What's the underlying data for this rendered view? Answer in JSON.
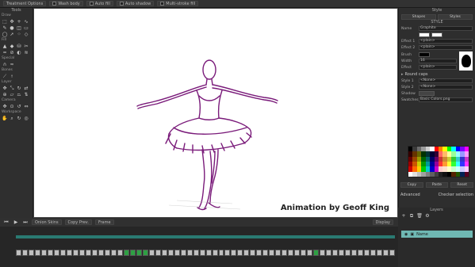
{
  "topbar": {
    "opts": [
      {
        "label": "Treatment Options"
      },
      {
        "label": "Wash body"
      },
      {
        "label": "Auto fill"
      },
      {
        "label": "Auto shadow"
      },
      {
        "label": "Multi-stroke fill"
      }
    ]
  },
  "tools": {
    "title": "Tools",
    "sections": [
      "Draw",
      "Fill",
      "Special",
      "Bones",
      "Layer",
      "Camera",
      "Workspace"
    ]
  },
  "canvas": {
    "credit": "Animation by Geoff King",
    "stroke_color": "#7a1b7a"
  },
  "right": {
    "title": "Style",
    "tabs": [
      "Shapes",
      "Styles"
    ],
    "style_header": "STYLE",
    "name_label": "Name",
    "name_value": "Graphite",
    "rows": [
      {
        "label": "Effect 1",
        "value": "<plain>"
      },
      {
        "label": "Effect 2",
        "value": "<plain>"
      },
      {
        "label": "Width",
        "value": "16"
      },
      {
        "label": "Effect",
        "value": "<plain>"
      }
    ],
    "brush_label": "Brush",
    "round_caps": "Round caps",
    "style1_label": "Style 1",
    "style1_value": "<None>",
    "style2_label": "Style 2",
    "style2_value": "<None>",
    "shadow_label": "Shadow",
    "swatches_label": "Swatches",
    "swatches_value": "Basic Colors.png",
    "copy": "Copy",
    "paste": "Paste",
    "reset": "Reset",
    "advanced": "Advanced",
    "checker": "Checker selection",
    "layers_title": "Layers",
    "layer_name": "Name"
  },
  "timeline": {
    "onion": "Onion Skins",
    "copy_prev": "Copy Prev.",
    "frame": "Frame",
    "display": "Display"
  },
  "swatch_colors": [
    "#000000",
    "#3a3a3a",
    "#6b6b6b",
    "#9b9b9b",
    "#cfcfcf",
    "#ffffff",
    "#ff0000",
    "#ff7f00",
    "#ffff00",
    "#00ff00",
    "#00ffff",
    "#0000ff",
    "#7f00ff",
    "#ff00ff",
    "#330000",
    "#663300",
    "#666600",
    "#003300",
    "#003333",
    "#000033",
    "#330033",
    "#ff6666",
    "#ffbb66",
    "#ffff99",
    "#99ff99",
    "#99ffff",
    "#9999ff",
    "#ff99ff",
    "#660000",
    "#994400",
    "#999900",
    "#006600",
    "#006666",
    "#000066",
    "#660066",
    "#cc3333",
    "#cc8833",
    "#cccc33",
    "#33cc33",
    "#33cccc",
    "#3333cc",
    "#cc33cc",
    "#990000",
    "#cc5500",
    "#cccc00",
    "#009900",
    "#009999",
    "#000099",
    "#990099",
    "#ff3333",
    "#ff9933",
    "#ffff33",
    "#33ff33",
    "#33ffff",
    "#3333ff",
    "#ff33ff",
    "#cc0000",
    "#ff6600",
    "#ffcc00",
    "#00cc00",
    "#00cccc",
    "#0000cc",
    "#cc00cc",
    "#ffcccc",
    "#ffe0cc",
    "#ffffcc",
    "#ccffcc",
    "#ccffff",
    "#ccccff",
    "#ffccff",
    "#ffffff",
    "#e0e0e0",
    "#c0c0c0",
    "#a0a0a0",
    "#808080",
    "#606060",
    "#404040",
    "#202020",
    "#101010",
    "#000000",
    "#552200",
    "#225500",
    "#002255",
    "#550022"
  ]
}
